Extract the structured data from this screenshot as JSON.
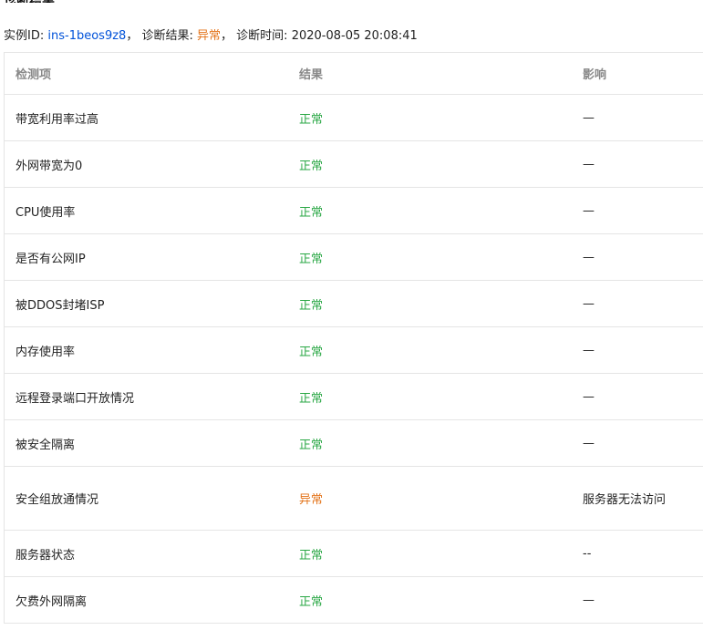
{
  "summary": {
    "instance_label": "实例ID:",
    "instance_id": "ins-1beos9z8",
    "sep1": "，",
    "result_label": "诊断结果:",
    "result_value": "异常",
    "sep2": "，",
    "time_label": "诊断时间:",
    "time_value": "2020-08-05 20:08:41"
  },
  "table": {
    "headers": [
      "检测项",
      "结果",
      "影响"
    ],
    "rows": [
      {
        "item": "带宽利用率过高",
        "result": "正常",
        "impact": "—",
        "status": "ok"
      },
      {
        "item": "外网带宽为0",
        "result": "正常",
        "impact": "—",
        "status": "ok"
      },
      {
        "item": "CPU使用率",
        "result": "正常",
        "impact": "—",
        "status": "ok"
      },
      {
        "item": "是否有公网IP",
        "result": "正常",
        "impact": "—",
        "status": "ok"
      },
      {
        "item": "被DDOS封堵ISP",
        "result": "正常",
        "impact": "—",
        "status": "ok"
      },
      {
        "item": "内存使用率",
        "result": "正常",
        "impact": "—",
        "status": "ok"
      },
      {
        "item": "远程登录端口开放情况",
        "result": "正常",
        "impact": "—",
        "status": "ok"
      },
      {
        "item": "被安全隔离",
        "result": "正常",
        "impact": "—",
        "status": "ok"
      },
      {
        "item": "安全组放通情况",
        "result": "异常",
        "impact": "服务器无法访问",
        "status": "bad"
      },
      {
        "item": "服务器状态",
        "result": "正常",
        "impact": "--",
        "status": "ok"
      },
      {
        "item": "欠费外网隔离",
        "result": "正常",
        "impact": "—",
        "status": "ok"
      }
    ]
  }
}
